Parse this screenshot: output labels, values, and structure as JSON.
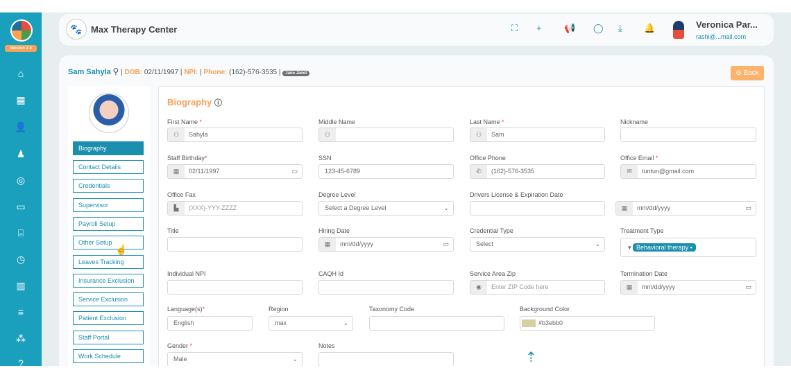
{
  "app": {
    "version": "Version 2.4",
    "title": "Max Therapy Center"
  },
  "sidebar": {
    "icons": [
      "home-icon",
      "calendar-icon",
      "add-user-icon",
      "user-icon",
      "settings-icon",
      "card-icon",
      "bank-icon",
      "clock-icon",
      "chart-icon",
      "menu-icon",
      "network-icon",
      "help-icon"
    ]
  },
  "header": {
    "icons": [
      "fullscreen-icon",
      "plus-icon",
      "megaphone-icon",
      "chat-icon",
      "download-icon",
      "bell-icon"
    ],
    "user_name": "Veronica Par...",
    "user_email": "rashi@...mail.com"
  },
  "patient": {
    "name": "Sam Sahyla",
    "dob_label": "DOB:",
    "dob": "02/11/1997",
    "npi_label": "NPI:",
    "phone_label": "Phone:",
    "phone": "(162)-576-3535",
    "badge": "Jane Janet"
  },
  "back_label": "⊖ Back",
  "tabs": [
    "Biography",
    "Contact Details",
    "Credentials",
    "Supervisor",
    "Payroll Setup",
    "Other Setup",
    "Leaves Tracking",
    "Insurance Exclusion",
    "Service Exclusion",
    "Patient Exclusion",
    "Staff Portal",
    "Work Schedule"
  ],
  "form": {
    "title": "Biography",
    "first_name": {
      "label": "First Name",
      "value": "Sahyla"
    },
    "middle_name": {
      "label": "Middle Name",
      "value": ""
    },
    "last_name": {
      "label": "Last Name",
      "value": "Sam"
    },
    "nickname": {
      "label": "Nickname",
      "value": ""
    },
    "birthday": {
      "label": "Staff Birthday",
      "value": "02/11/1997"
    },
    "ssn": {
      "label": "SSN",
      "value": "123-45-6789"
    },
    "office_phone": {
      "label": "Office Phone",
      "value": "(162)-576-3535"
    },
    "office_email": {
      "label": "Office Email",
      "value": "tuntun@gmail.com"
    },
    "office_fax": {
      "label": "Office Fax",
      "placeholder": "(XXX)-YYY-ZZZZ"
    },
    "degree": {
      "label": "Degree Level",
      "value": "Select a Degree Level"
    },
    "license": {
      "label": "Drivers License & Expiration Date",
      "value": "",
      "date": "mm/dd/yyyy"
    },
    "title_f": {
      "label": "Title",
      "value": ""
    },
    "hiring": {
      "label": "Hiring Date",
      "value": "mm/dd/yyyy"
    },
    "cred_type": {
      "label": "Credential Type",
      "value": "Select"
    },
    "treatment": {
      "label": "Treatment Type",
      "chip": "Behavioral therapy"
    },
    "npi": {
      "label": "Individual NPI",
      "value": ""
    },
    "caqh": {
      "label": "CAQH Id",
      "value": ""
    },
    "zip": {
      "label": "Service Area Zip",
      "placeholder": "Enter ZIP Code here"
    },
    "termination": {
      "label": "Termination Date",
      "value": "mm/dd/yyyy"
    },
    "language": {
      "label": "Language(s)",
      "value": "English"
    },
    "region": {
      "label": "Region",
      "value": "max"
    },
    "taxonomy": {
      "label": "Taxonomy Code",
      "value": ""
    },
    "bg_color": {
      "label": "Background Color",
      "value": "#b3ebb0"
    },
    "gender": {
      "label": "Gender",
      "value": "Male"
    },
    "notes": {
      "label": "Notes",
      "value": ""
    }
  }
}
